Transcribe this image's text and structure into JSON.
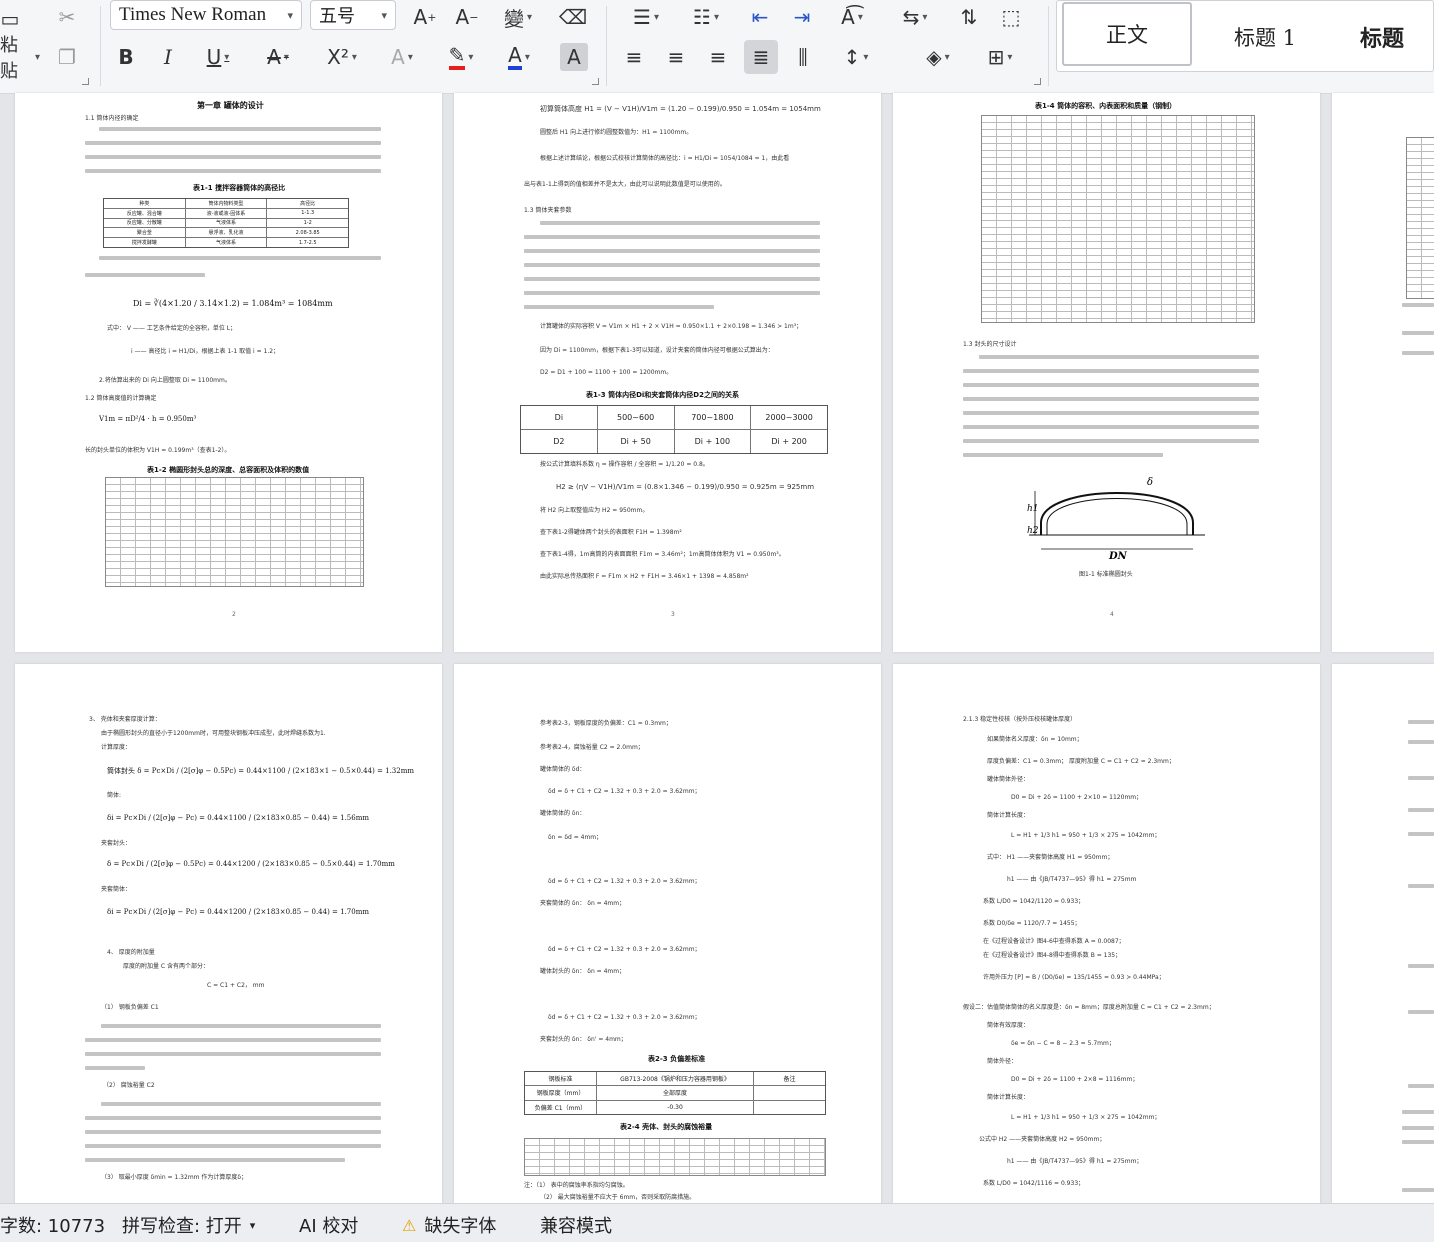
{
  "ribbon": {
    "cut_label": "",
    "paste_label": "粘贴",
    "font_name": "Times New Roman",
    "font_size": "五号",
    "bold": "B",
    "italic": "I",
    "underline": "U",
    "strikethrough": "A",
    "superscript": "X²",
    "styles": [
      "正文",
      "标题 1",
      "标题"
    ]
  },
  "pages": {
    "p2": {
      "chapter_title": "第一章 罐体的设计",
      "sec_1_1": "1.1 筒体内径的确定",
      "table_1_1_title": "表1-1 搅拌容器筒体的高径比",
      "table_1_1": {
        "headers": [
          "种类",
          "筒体内物料类型",
          "高径比"
        ],
        "rows": [
          [
            "反应罐、混合罐",
            "液-液或液-固体系",
            "1-1.3"
          ],
          [
            "反应罐、分散罐",
            "气液体系",
            "1-2"
          ],
          [
            "聚合釜",
            "悬浮液、乳化液",
            "2.08-3.85"
          ],
          [
            "搅拌发酵罐",
            "气液体系",
            "1.7-2.5"
          ]
        ]
      },
      "formula_d": "Di = ∛(4×1.20 / 3.14×1.2) = 1.084m³ = 1084mm",
      "note_v": "式中：  V —— 工艺条件给定的全容积，单位 L；",
      "note_i": "i —— 高径比 i = H1/Di，根据上表 1-1 取值 i = 1.2；",
      "rounded": "2.将估算出来的 Di 向上圆整取 Di = 1100mm。",
      "sec_1_2": "1.2 筒体高度值的计算确定",
      "formula_v1m": "V1m = πD²/4 · h = 0.950m³",
      "formula_vh": "长的封头单位的体积为 V1H = 0.199m³（查表1-2）。",
      "table_1_2_title": "表1-2 椭圆形封头总的深度、总容面积及体积的数值",
      "page_number": "2"
    },
    "p3": {
      "formula_h1": "初算筒体高度 H1 = (V − V1H)/V1m = (1.20 − 0.199)/0.950 = 1.054m = 1054mm",
      "round_h1": "圆整后 H1 向上进行修约圆整数值为：H1 = 1100mm。",
      "check_i": "根据上述计算结论，根据公式校核计算筒体的高径比：i = H1/Di = 1054/1084 ≈ 1，由此看",
      "check_note": "出与表1-1上得到的值相差并不是太大，由此可以说明此数值是可以使用的。",
      "sec_1_3": "1.3 筒体夹套参数",
      "formula_v": "计算罐体的实际容积 V = V1m × H1 + 2 × V1H = 0.950×1.1 + 2×0.198 = 1.346 > 1m³；",
      "di_note": "因为 Di = 1100mm，根据下表1-3可以知道，设计夹套的筒体内径可根据公式算出为：",
      "formula_d2": "D2 = D1 + 100 = 1100 + 100 = 1200mm。",
      "table_1_3_title": "表1-3 筒体内径Di和夹套筒体内径D2之间的关系",
      "table_1_3": {
        "row1": [
          "Di",
          "500~600",
          "700~1800",
          "2000~3000"
        ],
        "row2": [
          "D2",
          "Di + 50",
          "Di + 100",
          "Di + 200"
        ]
      },
      "eta": "按公式计算填料系数 η = 操作容积 / 全容积 = 1/1.20 = 0.8。",
      "formula_h2": "H2 ≥ (ηV − V1H)/V1m = (0.8×1.346 − 0.199)/0.950 = 0.925m = 925mm",
      "h2_round": "将 H2 向上取整值应为 H2 = 950mm。",
      "f1h": "查下表1-2得罐体两个封头的表面积 F1H = 1.398m²",
      "f1m": "查下表1-4得，1m高筒的内表面面积 F1m = 3.46m²；1m高筒体体积为 V1 = 0.950m³。",
      "f_total": "由此实际总传热面积 F = F1m × H2 + F1H = 3.46×1 + 1398 = 4.858m²",
      "page_number": "3"
    },
    "p4": {
      "table_1_4_title": "表1-4 筒体的容积、内表面积和质量（钢制）",
      "sec_1_3": "1.3 封头的尺寸设计",
      "fig_caption": "图1-1 标准椭圆封头",
      "fig_labels": {
        "dn": "DN",
        "h1": "h1",
        "h2": "h2",
        "delta": "δ"
      },
      "page_number": "4"
    },
    "p5": {
      "header_3": "3、 壳体和夹套厚度计算：",
      "intro": "由于椭圆形封头的直径小于1200mm时，可用整块钢板冲压成型，此时焊缝系数为1.",
      "calc_thickness": "计算厚度：",
      "formula_head": "筒体封头 δ = Pc×Di / (2[σ]φ − 0.5Pc) = 0.44×1100 / (2×183×1 − 0.5×0.44) = 1.32mm",
      "body": "筒体:",
      "formula_body": "δi = Pc×Di / (2[σ]φ − Pc) = 0.44×1100 / (2×183×0.85 − 0.44) = 1.56mm",
      "jacket_head": "夹套封头：",
      "formula_jacket_head": "δ = Pc×Di / (2[σ]φ − 0.5Pc) = 0.44×1200 / (2×183×0.85 − 0.5×0.44) = 1.70mm",
      "jacket_body": "夹套筒体：",
      "formula_jacket_body": "δi = Pc×Di / (2[σ]φ − Pc) = 0.44×1200 / (2×183×0.85 − 0.44) = 1.70mm",
      "header_4": "4、 厚度的附加量",
      "add_note": "厚度的附加量 C 含有两个部分：",
      "formula_c": "C = C1 + C2， mm",
      "c1": "（1） 钢板负偏差 C1",
      "c2": "（2） 腐蚀裕量 C2",
      "take_delta": "（3） 取最小厚度 δmin = 1.32mm 作为计算厚度δ；"
    },
    "p6": {
      "ref_c1": "参考表2-3，钢板厚度的负偏差：C1 = 0.3mm；",
      "ref_c2": "参考表2-4，腐蚀裕量 C2 = 2.0mm；",
      "body_label": "罐体筒体的 δd：",
      "formula_1": "δd = δ + C1 + C2 = 1.32 + 0.3 + 2.0 = 3.62mm；",
      "body_label_2": "罐体筒体的 δn：",
      "formula_2": "δn = δd = 4mm；",
      "formula_3": "δd = δ + C1 + C2 = 1.32 + 0.3 + 2.0 = 3.62mm；",
      "formula_4": "夹套筒体的 δn： δn = 4mm；",
      "formula_5": "δd = δ + C1 + C2 = 1.32 + 0.3 + 2.0 = 3.62mm；",
      "formula_6": "罐体封头的 δn： δn = 4mm；",
      "formula_7": "δd = δ + C1 + C2 = 1.32 + 0.3 + 2.0 = 3.62mm；",
      "formula_8": "夹套封头的 δn： δn' = 4mm；",
      "table_2_3_title": "表2-3 负偏差标准",
      "table_2_3": {
        "row1": [
          "钢板标准",
          "GB713-2008《锅炉和压力容器用钢板》",
          "备注"
        ],
        "row2": [
          "钢板厚度（mm）",
          "全部厚度",
          ""
        ],
        "row3": [
          "负偏差 C1（mm）",
          "-0.30",
          ""
        ]
      },
      "table_2_4_title": "表2-4 壳体、封头的腐蚀裕量",
      "note_1": "注：（1） 表中的腐蚀率系指均匀腐蚀。",
      "note_2": "（2） 最大腐蚀裕量不应大于 6mm，否则采取防腐措施。"
    },
    "p7": {
      "header": "2.1.3 稳定性校核（按外压校核罐体厚度）",
      "assume": "如果筒体名义厚度：δn = 10mm；",
      "c": "厚度负偏差：C1 = 0.3mm； 厚度附加量 C = C1 + C2 = 2.3mm；",
      "outer": "罐体筒体外径：",
      "formula_d0": "D0 = Di + 2δ = 1100 + 2×10 = 1120mm；",
      "length": "筒体计算长度：",
      "formula_l": "L = H1 + 1/3 h1 = 950 + 1/3 × 275 = 1042mm；",
      "note_h": "式中：  H1 ——夹套筒体高度 H1 = 950mm；",
      "note_h1": "h1 —— 由《JB/T4737—95》得 h1 = 275mm",
      "ratio_1": "系数 L/D0 = 1042/1120 = 0.933；",
      "ratio_2": "系数 D0/δe = 1120/7.7 = 1455；",
      "a_value": "在《过程设备设计》图4-6中查得系数 A = 0.0087；",
      "b_value": "在《过程设备设计》图4-8得中查得系数 B = 135；",
      "formula_p": "许用外压力 [P] = B / (D0/δe) = 135/1455 = 0.93 > 0.44MPa；",
      "assume_2": "假设二：估值筒体筒体的名义厚度是：δn = 8mm；厚度总附加量 C = C1 + C2 = 2.3mm；",
      "eff": "筒体有效厚度：",
      "formula_de": "δe = δn − C = 8 − 2.3 = 5.7mm；",
      "outer_2": "筒体外径：",
      "formula_d0_2": "D0 = Di + 2δ = 1100 + 2×8 = 1116mm；",
      "length_2": "筒体计算长度：",
      "formula_l_2": "L = H1 + 1/3 h1 = 950 + 1/3 × 275 = 1042mm；",
      "note_h_2": "公式中 H2 ——夹套筒体高度 H2 = 950mm；",
      "note_h1_2": "h1 —— 由《JB/T4737—95》得 h1 = 275mm；",
      "ratio_3": "系数 L/D0 = 1042/1116 = 0.933；"
    }
  },
  "statusbar": {
    "word_count": "字数: 10773",
    "spell_check": "拼写检查: 打开",
    "ai_check": "AI 校对",
    "missing_font": "缺失字体",
    "compat_mode": "兼容模式"
  }
}
